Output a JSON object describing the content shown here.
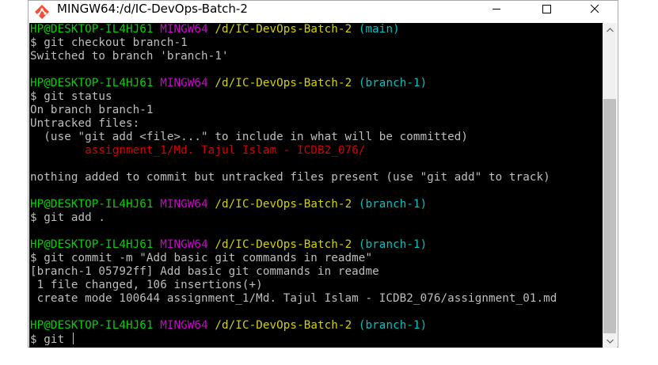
{
  "window": {
    "title": "MINGW64:/d/IC-DevOps-Batch-2"
  },
  "colors": {
    "user": "#00d200",
    "msystem": "#d200d2",
    "path": "#d2d200",
    "branch": "#00c0c0",
    "untracked": "#d20000",
    "text": "#bfbfbf",
    "background": "#000000"
  },
  "terminal": {
    "p1": {
      "user": "HP@DESKTOP-IL4HJ61",
      "msys": "MINGW64",
      "path": "/d/IC-DevOps-Batch-2",
      "branch": "(main)"
    },
    "l2": "$ git checkout branch-1",
    "l3": "Switched to branch 'branch-1'",
    "p2": {
      "user": "HP@DESKTOP-IL4HJ61",
      "msys": "MINGW64",
      "path": "/d/IC-DevOps-Batch-2",
      "branch": "(branch-1)"
    },
    "l6": "$ git status",
    "l7": "On branch branch-1",
    "l8": "Untracked files:",
    "l9": "  (use \"git add <file>...\" to include in what will be committed)",
    "l10": "        assignment_1/Md. Tajul Islam - ICDB2_076/",
    "l12": "nothing added to commit but untracked files present (use \"git add\" to track)",
    "p3": {
      "user": "HP@DESKTOP-IL4HJ61",
      "msys": "MINGW64",
      "path": "/d/IC-DevOps-Batch-2",
      "branch": "(branch-1)"
    },
    "l15": "$ git add .",
    "p4": {
      "user": "HP@DESKTOP-IL4HJ61",
      "msys": "MINGW64",
      "path": "/d/IC-DevOps-Batch-2",
      "branch": "(branch-1)"
    },
    "l18": "$ git commit -m \"Add basic git commands in readme\"",
    "l19": "[branch-1 05792ff] Add basic git commands in readme",
    "l20": " 1 file changed, 106 insertions(+)",
    "l21": " create mode 100644 assignment_1/Md. Tajul Islam - ICDB2_076/assignment_01.md",
    "p5": {
      "user": "HP@DESKTOP-IL4HJ61",
      "msys": "MINGW64",
      "path": "/d/IC-DevOps-Batch-2",
      "branch": "(branch-1)"
    },
    "l24": "$ git "
  }
}
